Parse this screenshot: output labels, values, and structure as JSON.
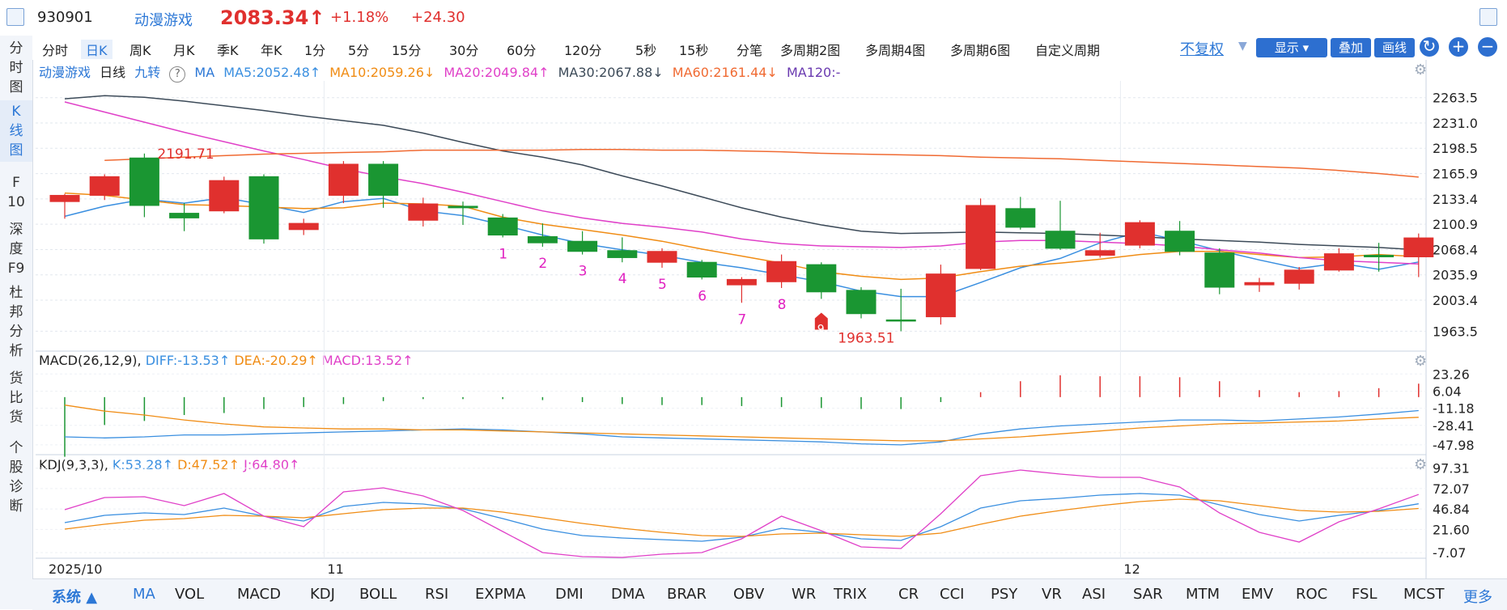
{
  "header": {
    "code": "930901",
    "name": "动漫游戏",
    "price": "2083.34",
    "arrow": "↑",
    "pct": "+1.18%",
    "change": "+24.30"
  },
  "left_nav": [
    {
      "label": "分\n时\n图",
      "active": false
    },
    {
      "label": "K\n线\n图",
      "active": true
    },
    {
      "label": "F\n10",
      "active": false
    },
    {
      "label": "深\n度\nF9",
      "active": false
    },
    {
      "label": "杜\n邦\n分\n析",
      "active": false
    },
    {
      "label": "货\n比\n货",
      "active": false
    },
    {
      "label": "个\n股\n诊\n断",
      "active": false
    }
  ],
  "period_tabs": [
    "分时",
    "日K",
    "周K",
    "月K",
    "季K",
    "年K",
    "1分",
    "5分",
    "15分",
    "30分",
    "60分",
    "120分",
    "5秒",
    "15秒",
    "分笔",
    "多周期2图",
    "多周期4图",
    "多周期6图",
    "自定义周期"
  ],
  "active_tab": "日K",
  "right_controls": {
    "fuquan": "不复权",
    "show": "显示",
    "overlay": "叠加",
    "draw": "画线",
    "refresh_icon": "↻",
    "plus_icon": "+",
    "minus_icon": "−"
  },
  "main_legend": {
    "name": "动漫游戏",
    "period": "日线",
    "jiuzhuan": "九转",
    "help": "?",
    "ma": "MA",
    "ma5": "MA5:2052.48↑",
    "ma10": "MA10:2059.26↓",
    "ma20": "MA20:2049.84↑",
    "ma30": "MA30:2067.88↓",
    "ma60": "MA60:2161.44↓",
    "ma120": "MA120:-"
  },
  "macd_legend": {
    "title": "MACD(26,12,9)",
    "diff": "DIFF:-13.53↑",
    "dea": "DEA:-20.29↑",
    "macd": "MACD:13.52↑"
  },
  "kdj_legend": {
    "title": "KDJ(9,3,3)",
    "k": "K:53.28↑",
    "d": "D:47.52↑",
    "j": "J:64.80↑"
  },
  "bottom_tabs": [
    "MA",
    "VOL",
    "MACD",
    "KDJ",
    "BOLL",
    "RSI",
    "EXPMA",
    "DMI",
    "DMA",
    "BRAR",
    "OBV",
    "WR",
    "TRIX",
    "CR",
    "CCI",
    "PSY",
    "VR",
    "ASI",
    "SAR",
    "MTM",
    "EMV",
    "ROC",
    "FSL",
    "MCST"
  ],
  "bottom_left": "系统",
  "bottom_more": "更多",
  "colors": {
    "up": "#e0302e",
    "down": "#1a9632",
    "ma5": "#3a8fe0",
    "ma10": "#f08c14",
    "ma20": "#e040c8",
    "ma30": "#3c4a58",
    "ma60": "#f06a32",
    "diff": "#3a8fe0",
    "dea": "#f08c14",
    "k": "#3a8fe0",
    "d": "#f08c14",
    "j": "#e040c8",
    "nine": "#e020c0"
  },
  "chart_data": {
    "type": "candlestick",
    "price_axis": {
      "ticks": [
        2263.5,
        2231.0,
        2198.5,
        2165.9,
        2133.4,
        2100.9,
        2068.4,
        2035.9,
        2003.4,
        1963.5
      ],
      "range": [
        1940,
        2285
      ]
    },
    "x_labels": [
      {
        "label": "2025/10",
        "index": 0
      },
      {
        "label": "11",
        "index": 7
      },
      {
        "label": "12",
        "index": 27
      }
    ],
    "annotations": [
      {
        "text": "2191.71",
        "index": 2,
        "value": 2191.71
      },
      {
        "text": "1963.51",
        "index": 21,
        "value": 1963.51
      }
    ],
    "nine_turn": [
      {
        "n": "1",
        "index": 11
      },
      {
        "n": "2",
        "index": 12
      },
      {
        "n": "3",
        "index": 13
      },
      {
        "n": "4",
        "index": 14
      },
      {
        "n": "5",
        "index": 15
      },
      {
        "n": "6",
        "index": 16
      },
      {
        "n": "7",
        "index": 17
      },
      {
        "n": "8",
        "index": 18
      },
      {
        "n": "9",
        "index": 19
      }
    ],
    "candles": [
      {
        "o": 2130,
        "c": 2138,
        "h": 2140,
        "l": 2108
      },
      {
        "o": 2138,
        "c": 2162,
        "h": 2165,
        "l": 2132
      },
      {
        "o": 2186,
        "c": 2125,
        "h": 2191.71,
        "l": 2110
      },
      {
        "o": 2115,
        "c": 2109,
        "h": 2128,
        "l": 2092
      },
      {
        "o": 2118,
        "c": 2157,
        "h": 2162,
        "l": 2115
      },
      {
        "o": 2162,
        "c": 2082,
        "h": 2165,
        "l": 2076
      },
      {
        "o": 2094,
        "c": 2102,
        "h": 2108,
        "l": 2087
      },
      {
        "o": 2138,
        "c": 2178,
        "h": 2182,
        "l": 2128
      },
      {
        "o": 2178,
        "c": 2138,
        "h": 2182,
        "l": 2122
      },
      {
        "o": 2106,
        "c": 2127,
        "h": 2135,
        "l": 2098
      },
      {
        "o": 2124,
        "c": 2122,
        "h": 2130,
        "l": 2100
      },
      {
        "o": 2109,
        "c": 2087,
        "h": 2114,
        "l": 2084
      },
      {
        "o": 2085,
        "c": 2077,
        "h": 2102,
        "l": 2072
      },
      {
        "o": 2079,
        "c": 2066,
        "h": 2092,
        "l": 2062
      },
      {
        "o": 2067,
        "c": 2058,
        "h": 2084,
        "l": 2052
      },
      {
        "o": 2052,
        "c": 2066,
        "h": 2070,
        "l": 2045
      },
      {
        "o": 2052,
        "c": 2033,
        "h": 2055,
        "l": 2030
      },
      {
        "o": 2023,
        "c": 2030,
        "h": 2033,
        "l": 2000
      },
      {
        "o": 2027,
        "c": 2053,
        "h": 2062,
        "l": 2019
      },
      {
        "o": 2049,
        "c": 2014,
        "h": 2052,
        "l": 2005
      },
      {
        "o": 2016,
        "c": 1986,
        "h": 2020,
        "l": 1980
      },
      {
        "o": 1978,
        "c": 1977,
        "h": 2018,
        "l": 1963.51
      },
      {
        "o": 1982,
        "c": 2037,
        "h": 2049,
        "l": 1972
      },
      {
        "o": 2044,
        "c": 2125,
        "h": 2134,
        "l": 2042
      },
      {
        "o": 2121,
        "c": 2097,
        "h": 2136,
        "l": 2094
      },
      {
        "o": 2092,
        "c": 2070,
        "h": 2131,
        "l": 2068
      },
      {
        "o": 2061,
        "c": 2067,
        "h": 2090,
        "l": 2058
      },
      {
        "o": 2074,
        "c": 2103,
        "h": 2106,
        "l": 2070
      },
      {
        "o": 2092,
        "c": 2066,
        "h": 2105,
        "l": 2061
      },
      {
        "o": 2064,
        "c": 2020,
        "h": 2070,
        "l": 2011
      },
      {
        "o": 2023,
        "c": 2026,
        "h": 2032,
        "l": 2014
      },
      {
        "o": 2025,
        "c": 2042,
        "h": 2046,
        "l": 2017
      },
      {
        "o": 2042,
        "c": 2063,
        "h": 2070,
        "l": 2040
      },
      {
        "o": 2061,
        "c": 2059,
        "h": 2077,
        "l": 2040
      },
      {
        "o": 2059,
        "c": 2083.34,
        "h": 2089,
        "l": 2033
      }
    ],
    "ma_series": [
      {
        "key": "ma5",
        "values": [
          2111,
          2124,
          2133,
          2128,
          2135,
          2126,
          2116,
          2130,
          2134,
          2118,
          2112,
          2100,
          2087,
          2076,
          2068,
          2061,
          2052,
          2045,
          2036,
          2027,
          2015,
          2008,
          2008,
          2026,
          2045,
          2057,
          2077,
          2091,
          2080,
          2067,
          2055,
          2044,
          2051,
          2043,
          2052.48
        ]
      },
      {
        "key": "ma10",
        "values": [
          2141,
          2138,
          2132,
          2126,
          2125,
          2123,
          2121,
          2122,
          2128,
          2127,
          2124,
          2110,
          2101,
          2094,
          2087,
          2079,
          2069,
          2060,
          2051,
          2040,
          2034,
          2030,
          2032,
          2040,
          2047,
          2051,
          2056,
          2062,
          2066,
          2066,
          2062,
          2058,
          2059,
          2062,
          2059.26
        ]
      },
      {
        "key": "ma20",
        "values": [
          2258,
          2245,
          2232,
          2219,
          2207,
          2195,
          2184,
          2172,
          2162,
          2153,
          2142,
          2130,
          2118,
          2109,
          2102,
          2097,
          2091,
          2082,
          2076,
          2073,
          2072,
          2071,
          2073,
          2078,
          2080,
          2080,
          2078,
          2076,
          2073,
          2068,
          2064,
          2058,
          2054,
          2052,
          2049.84
        ]
      },
      {
        "key": "ma30",
        "values": [
          2262,
          2266,
          2264,
          2259,
          2253,
          2247,
          2240,
          2234,
          2228,
          2218,
          2206,
          2195,
          2187,
          2177,
          2163,
          2150,
          2136,
          2122,
          2110,
          2100,
          2092,
          2089,
          2090,
          2091,
          2090,
          2089,
          2087,
          2085,
          2082,
          2080,
          2078,
          2075,
          2073,
          2071,
          2067.88
        ]
      },
      {
        "key": "ma60",
        "values": [
          null,
          2183,
          2185,
          2187,
          2189,
          2191,
          2192,
          2193,
          2194,
          2196,
          2196,
          2196,
          2196,
          2197,
          2197,
          2196,
          2196,
          2195,
          2194,
          2192,
          2191,
          2190,
          2189,
          2187,
          2186,
          2185,
          2183,
          2181,
          2179,
          2177,
          2175,
          2173,
          2170,
          2166,
          2161.44
        ]
      }
    ],
    "macd": {
      "axis_ticks": [
        23.26,
        6.04,
        -11.18,
        -28.41,
        -47.98
      ],
      "range": [
        -53,
        30
      ],
      "bars": [
        -60,
        -28,
        -24,
        -18,
        -16,
        -12,
        -10,
        -7,
        -4,
        -2,
        -2,
        -2,
        -3,
        -5,
        -7,
        -8,
        -8,
        -9,
        -10,
        -11,
        -12,
        -12,
        -5,
        5,
        16,
        22,
        21,
        21,
        20,
        16,
        7,
        5,
        6,
        9,
        13.52
      ],
      "diff": [
        -40,
        -41,
        -40,
        -38,
        -38,
        -37,
        -36,
        -35,
        -34,
        -33,
        -32,
        -33,
        -35,
        -37,
        -40,
        -41,
        -42,
        -43,
        -44,
        -45,
        -47,
        -48,
        -45,
        -37,
        -32,
        -29,
        -27,
        -25,
        -23,
        -23,
        -24,
        -22,
        -20,
        -17,
        -13.53
      ],
      "dea": [
        -8,
        -14,
        -18,
        -23,
        -27,
        -30,
        -31,
        -32,
        -32,
        -33,
        -33,
        -34,
        -35,
        -36,
        -37,
        -38,
        -39,
        -40,
        -41,
        -42,
        -43,
        -44,
        -44,
        -42,
        -40,
        -37,
        -34,
        -31,
        -29,
        -27,
        -26,
        -25,
        -24,
        -22,
        -20.29
      ]
    },
    "kdj": {
      "axis_ticks": [
        97.31,
        72.07,
        46.84,
        21.6,
        -7.07
      ],
      "range": [
        -12,
        108
      ],
      "k": [
        30,
        39,
        42,
        40,
        48,
        38,
        32,
        50,
        55,
        53,
        47,
        35,
        22,
        14,
        11,
        9,
        7,
        12,
        23,
        18,
        10,
        8,
        25,
        48,
        57,
        60,
        64,
        66,
        64,
        52,
        40,
        32,
        39,
        45,
        53.28
      ],
      "d": [
        22,
        28,
        33,
        35,
        39,
        38,
        36,
        41,
        46,
        48,
        48,
        43,
        36,
        29,
        23,
        18,
        14,
        13,
        16,
        17,
        15,
        13,
        17,
        28,
        38,
        45,
        51,
        56,
        59,
        57,
        51,
        45,
        43,
        44,
        47.52
      ],
      "j": [
        46,
        61,
        62,
        51,
        66,
        38,
        25,
        68,
        73,
        63,
        45,
        19,
        -7,
        -12,
        -13,
        -9,
        -7,
        10,
        38,
        20,
        0,
        -2,
        41,
        88,
        95,
        90,
        86,
        86,
        74,
        42,
        18,
        6,
        31,
        47,
        64.8
      ]
    }
  }
}
